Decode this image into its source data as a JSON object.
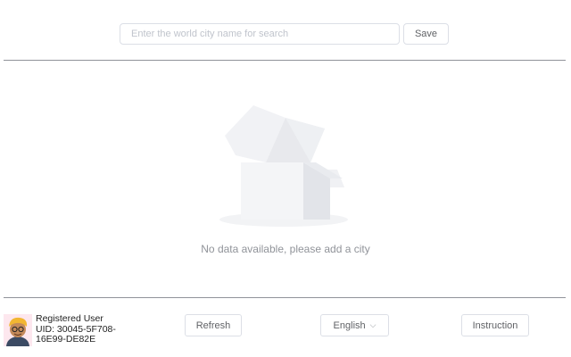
{
  "search": {
    "placeholder": "Enter the world city name for search",
    "value": ""
  },
  "toolbar": {
    "save_label": "Save"
  },
  "empty_state": {
    "message": "No data available, please add a city",
    "icon": "empty-box-icon"
  },
  "user": {
    "role": "Registered User",
    "uid_line1": "UID: 30045-5F708-",
    "uid_line2": "16E99-DE82E"
  },
  "footer": {
    "refresh_label": "Refresh",
    "language_label": "English",
    "language_chevron": "⌵",
    "instruction_label": "Instruction"
  }
}
